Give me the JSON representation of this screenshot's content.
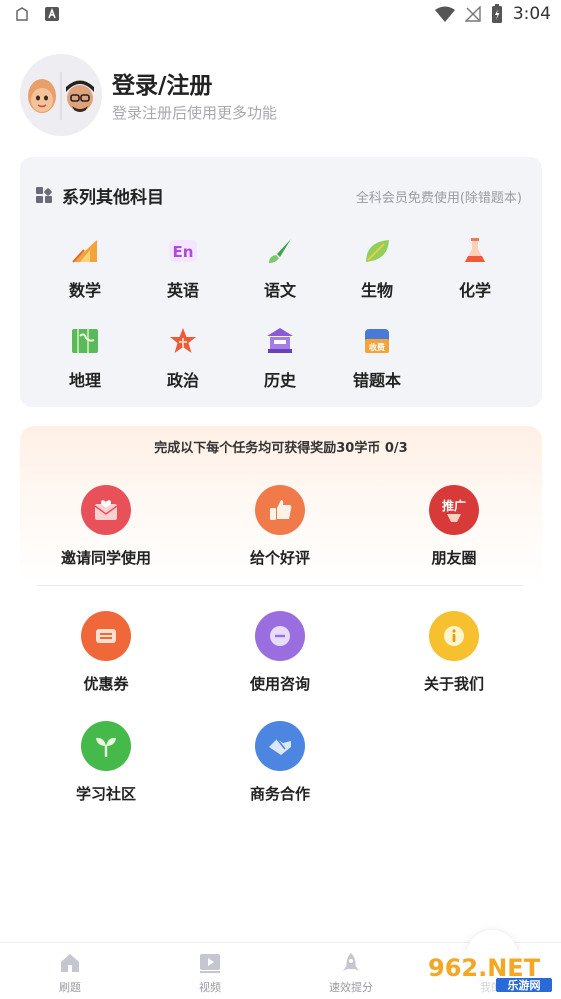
{
  "status_bar": {
    "time": "3:04"
  },
  "profile": {
    "title": "登录/注册",
    "subtitle": "登录注册后使用更多功能"
  },
  "subjects_card": {
    "title": "系列其他科目",
    "note": "全科会员免费使用(除错题本)",
    "items": [
      {
        "label": "数学",
        "icon": "protractor-icon"
      },
      {
        "label": "英语",
        "icon": "en-icon"
      },
      {
        "label": "语文",
        "icon": "brush-icon"
      },
      {
        "label": "生物",
        "icon": "leaf-icon"
      },
      {
        "label": "化学",
        "icon": "flask-icon"
      },
      {
        "label": "地理",
        "icon": "map-icon"
      },
      {
        "label": "政治",
        "icon": "star-icon"
      },
      {
        "label": "历史",
        "icon": "building-icon"
      },
      {
        "label": "错题本",
        "icon": "notebook-icon",
        "badge": "收费"
      }
    ]
  },
  "tasks": {
    "banner": "完成以下每个任务均可获得奖励30学币 0/3",
    "items": [
      {
        "label": "邀请同学使用",
        "icon": "invite-icon"
      },
      {
        "label": "给个好评",
        "icon": "thumbs-up-icon"
      },
      {
        "label": "朋友圈",
        "icon": "promote-icon",
        "badge": "推广"
      }
    ]
  },
  "actions": [
    {
      "label": "优惠券",
      "icon": "coupon-icon"
    },
    {
      "label": "使用咨询",
      "icon": "chat-icon"
    },
    {
      "label": "关于我们",
      "icon": "info-icon"
    },
    {
      "label": "学习社区",
      "icon": "sprout-icon"
    },
    {
      "label": "商务合作",
      "icon": "handshake-icon"
    }
  ],
  "bottom_nav": [
    {
      "label": "刷题",
      "icon": "home-icon"
    },
    {
      "label": "视频",
      "icon": "video-icon"
    },
    {
      "label": "速效提分",
      "icon": "rocket-icon"
    },
    {
      "label": "我的",
      "icon": "profile-icon"
    }
  ],
  "watermark": {
    "text": "962.NET",
    "subtext": "乐游网"
  },
  "colors": {
    "card_bg": "#f3f4f7",
    "invite": "#e8515a",
    "thumb": "#f07a4a",
    "promote": "#d83a3a",
    "coupon": "#f0673a",
    "chat": "#9b6ee0",
    "info": "#f6c02e",
    "sprout": "#45b94a",
    "handshake": "#4c86e0"
  }
}
